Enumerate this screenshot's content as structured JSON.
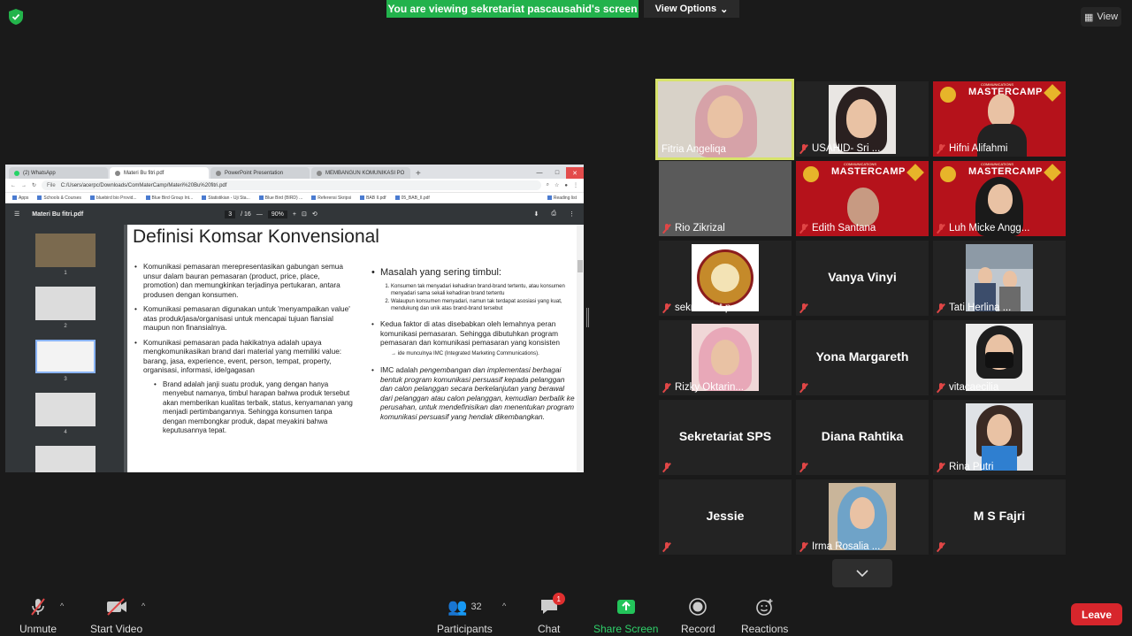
{
  "banner": {
    "text": "You are viewing sekretariat pascausahid's screen",
    "view_options": "View Options"
  },
  "view_button": "View",
  "browser": {
    "tabs": [
      "(2) WhatsApp",
      "Materi Bu fitri.pdf",
      "PowerPoint Presentation",
      "MEMBANGUN KOMUNIKASI PO"
    ],
    "url_prefix": "File",
    "url": "C:/Users/acerpc/Downloads/ComMaterCamp/Materi%20Bu%20fitri.pdf",
    "bookmarks": [
      "Apps",
      "Schools & Courses",
      "bluebird bio Provid...",
      "Blue Bird Group Int...",
      "Statistikian - Uji Sta...",
      "Blue Bird (BIRD) ...",
      "Referensi Skripsi",
      "BAB II.pdf",
      "05_BAB_II.pdf",
      "Reading list"
    ]
  },
  "pdf": {
    "filename": "Materi Bu fitri.pdf",
    "page_current": "3",
    "page_total": "/ 16",
    "zoom": "90%",
    "thumbnail_numbers": [
      "1",
      "2",
      "3",
      "4"
    ],
    "slide_title": "Definisi Komsar Konvensional",
    "left_bullets": [
      "Komunikasi pemasaran merepresentasikan gabungan semua unsur dalam bauran pemasaran (product, price, place, promotion) dan memungkinkan terjadinya pertukaran, antara produsen dengan konsumen.",
      "Komunikasi pemasaran digunakan untuk 'menyampaikan value' atas produk/jasa/organisasi untuk mencapai tujuan fiansial maupun non finansialnya.",
      "Komunikasi pemasaran pada hakikatnya adalah upaya mengkomunikasikan brand dari material yang memiliki value: barang, jasa, experience, event, person, tempat, property, organisasi, informasi, ide/gagasan",
      "Brand adalah janji suatu produk, yang dengan hanya menyebut namanya, timbul harapan bahwa produk tersebut akan memberikan kualitas terbaik, status, kenyamanan yang menjadi pertimbangannya. Sehingga konsumen tanpa dengan membongkar produk, dapat meyakini bahwa keputusannya tepat."
    ],
    "right_heading": "Masalah yang sering timbul:",
    "right_list": [
      "Konsumen tak menyadari kehadiran brand-brand tertentu, atau konsumen menyadari sama sekali kehadiran brand tertentu",
      "Walaupun konsumen menyadari, namun tak terdapat asosiasi yang kuat, mendukung dan unik atas brand-brand tersebut"
    ],
    "right_bullet_2": "Kedua faktor di atas disebabkan oleh lemahnya peran komunikasi pemasaran. Sehingga dibutuhkan program pemasaran dan komunikasi pemasaran yang konsisten",
    "right_arrow": "→ ide munculnya IMC (Integrated Marketing Communications).",
    "right_bullet_3_lead": "IMC adalah",
    "right_bullet_3": "pengembangan dan implementasi berbagai bentuk program komunikasi persuasif kepada pelanggan dan calon pelanggan secara berkelanjutan yang berawal dari pelanggan atau calon pelanggan, kemudian berbalik ke perusahan, untuk mendefinisikan dan menentukan program komunikasi persuasif yang hendak dikembangkan."
  },
  "participants_tiles": [
    {
      "name": "Fitria Angeliqa",
      "muted": false,
      "active": true
    },
    {
      "name": "USAHID- Sri ...",
      "muted": true
    },
    {
      "name": "Hifni Alifahmi",
      "muted": true
    },
    {
      "name": "Rio Zikrizal",
      "muted": true
    },
    {
      "name": "Edith Santana",
      "muted": true
    },
    {
      "name": "Luh Micke Angg...",
      "muted": true
    },
    {
      "name": "sekretariat p...",
      "muted": true
    },
    {
      "name": "Vanya Vinyi",
      "muted": true
    },
    {
      "name": "Tati Herlina ...",
      "muted": true
    },
    {
      "name": "Rizky Oktarin...",
      "muted": true
    },
    {
      "name": "Yona Margareth",
      "muted": true
    },
    {
      "name": "vitacaecilia",
      "muted": true
    },
    {
      "name": "Sekretariat SPS",
      "muted": true
    },
    {
      "name": "Diana Rahtika",
      "muted": true
    },
    {
      "name": "Rina Putri",
      "muted": true
    },
    {
      "name": "Jessie",
      "muted": true
    },
    {
      "name": "Irma Rosalia ...",
      "muted": true
    },
    {
      "name": "M S Fajri",
      "muted": true
    }
  ],
  "poster": {
    "brand": "MASTERCAMP",
    "small": "COMMUNICATIONS"
  },
  "toolbar": {
    "unmute": "Unmute",
    "start_video": "Start Video",
    "participants": "Participants",
    "participants_count": "32",
    "chat": "Chat",
    "chat_badge": "1",
    "share_screen": "Share Screen",
    "record": "Record",
    "reactions": "Reactions",
    "leave": "Leave"
  },
  "colors": {
    "active_border": "#d7e36b",
    "banner_green": "#22b24c",
    "leave_red": "#d7262c",
    "muted_red": "#e04646"
  }
}
